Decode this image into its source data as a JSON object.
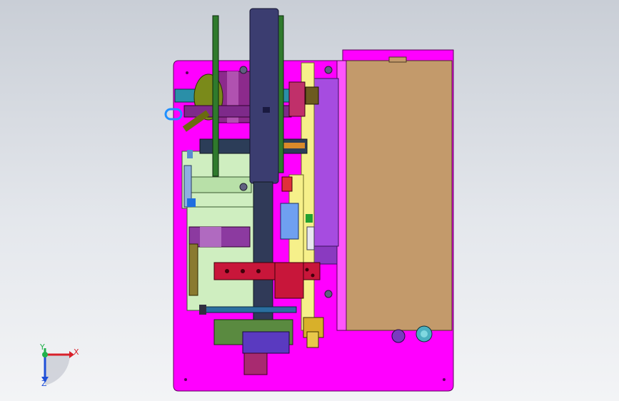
{
  "viewport": {
    "background_top": "#c9ced6",
    "background_bottom": "#f3f4f6"
  },
  "model": {
    "base_plate_color": "#ff00ff",
    "enclosure_color": "#c39a6b",
    "flywheel_color": "#3b3d70",
    "belt_color": "#2f7a2c",
    "frame_color": "#f6f08a",
    "bracket_color": "#c8163a",
    "panel_color": "#a64ce0",
    "plate_color": "#cfeec0"
  },
  "triad": {
    "x_label": "X",
    "y_label": "Y",
    "z_label": "Z",
    "x_color": "#d8202a",
    "y_color": "#22b14c",
    "z_color": "#1f4fd8"
  }
}
